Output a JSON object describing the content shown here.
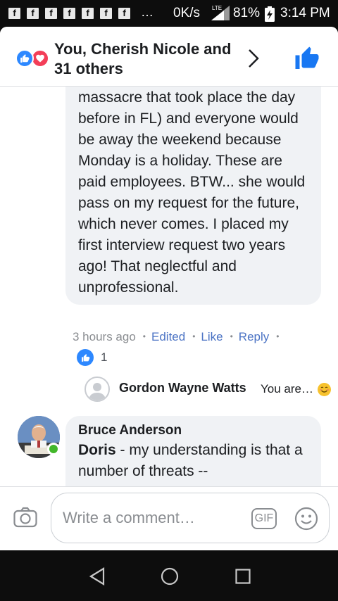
{
  "status_bar": {
    "app_icons": [
      "f",
      "f",
      "f",
      "f",
      "f",
      "f",
      "f"
    ],
    "overflow": "…",
    "network_speed": "0K/s",
    "network_type": "LTE",
    "battery": "81%",
    "time": "3:14 PM"
  },
  "header": {
    "reactors": "You, Cherish Nicole and 31 others",
    "icons": [
      "like-reaction-icon",
      "love-reaction-icon",
      "chevron-right-icon",
      "thumbs-up-icon"
    ],
    "colors": {
      "like": "#2d88ff",
      "love": "#f33e58",
      "accent": "#1877f2"
    }
  },
  "comment_1": {
    "text": "massacre that took place the day before in FL) and everyone would be away the weekend because Monday is a holiday. These are paid employees. BTW... she would pass on my request for the future, which never comes. I placed my first interview request two years ago! That neglectful and unprofessional.",
    "time": "3 hours ago",
    "edited": "Edited",
    "like": "Like",
    "reply": "Reply",
    "like_count": "1"
  },
  "reply_preview": {
    "name": "Gordon Wayne Watts",
    "text": "You are…",
    "emoji": "smiling-face-icon"
  },
  "comment_2": {
    "name": "Bruce Anderson",
    "mention": "Doris",
    "text": " - my understanding is that a number of threats --"
  },
  "composer": {
    "placeholder": "Write a comment…",
    "gif_label": "GIF"
  }
}
